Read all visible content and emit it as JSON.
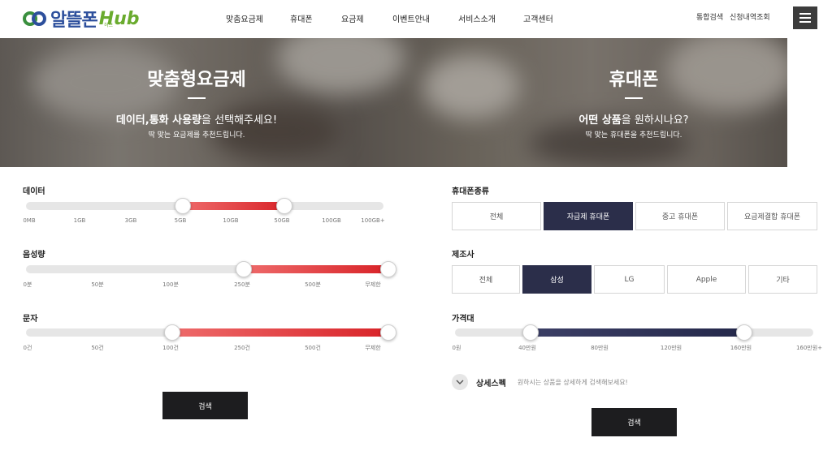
{
  "header": {
    "logo_text": "알뜰폰",
    "logo_hub": "Hub",
    "logo_sub": "허브",
    "nav": [
      "맞춤요금제",
      "휴대폰",
      "요금제",
      "이벤트안내",
      "서비스소개",
      "고객센터"
    ],
    "util": [
      "통합검색",
      "신청내역조회"
    ]
  },
  "banner": {
    "left": {
      "title": "맞춤형요금제",
      "sub_bold": "데이터,통화 사용량",
      "sub_rest": "을 선택해주세요!",
      "small": "딱 맞는 요금제를 추천드립니다."
    },
    "right": {
      "title": "휴대폰",
      "sub_bold": "어떤 상품",
      "sub_rest": "을 원하시나요?",
      "small": "딱 맞는 휴대폰을 추천드립니다."
    }
  },
  "plan": {
    "data": {
      "label": "데이터",
      "ticks": [
        "0MB",
        "1GB",
        "3GB",
        "5GB",
        "10GB",
        "50GB",
        "100GB",
        "100GB+"
      ],
      "selected": [
        "5GB",
        "50GB"
      ]
    },
    "voice": {
      "label": "음성량",
      "ticks": [
        "0분",
        "50분",
        "100분",
        "250분",
        "500분",
        "무제한"
      ],
      "selected": [
        "250분",
        "무제한"
      ]
    },
    "sms": {
      "label": "문자",
      "ticks": [
        "0건",
        "50건",
        "100건",
        "250건",
        "500건",
        "무제한"
      ],
      "selected": [
        "100건",
        "무제한"
      ]
    },
    "search_label": "검색"
  },
  "phone": {
    "type": {
      "label": "휴대폰종류",
      "options": [
        "전체",
        "자급제 휴대폰",
        "중고 휴대폰",
        "요금제결합 휴대폰"
      ],
      "active": "자급제 휴대폰"
    },
    "maker": {
      "label": "제조사",
      "options": [
        "전체",
        "삼성",
        "LG",
        "Apple",
        "기타"
      ],
      "active": "삼성"
    },
    "price": {
      "label": "가격대",
      "ticks": [
        "0원",
        "40만원",
        "80만원",
        "120만원",
        "160만원",
        "160만원+"
      ],
      "selected": [
        "40만원",
        "160만원"
      ]
    },
    "detail_label": "상세스펙",
    "detail_desc": "원하시는 상품을 상세하게 검색해보세요!",
    "search_label": "검색"
  },
  "colors": {
    "red": "#d9252a",
    "navy": "#2b2e4a",
    "dark": "#1d1d1f",
    "logo_blue": "#2d4f9c",
    "logo_green": "#6aab2e"
  }
}
